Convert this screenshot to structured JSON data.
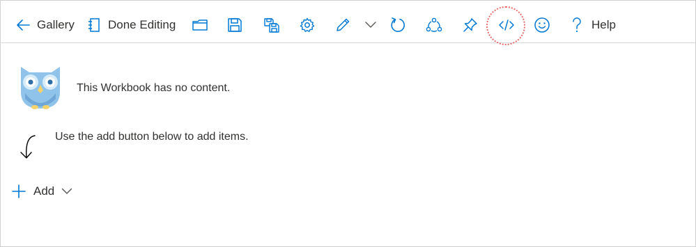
{
  "toolbar": {
    "gallery_label": "Gallery",
    "done_editing_label": "Done Editing",
    "help_label": "Help",
    "icons": [
      "back-arrow-icon",
      "done-editing-icon",
      "open-folder-icon",
      "save-icon",
      "save-as-icon",
      "settings-gear-icon",
      "edit-pencil-icon",
      "chevron-down-icon",
      "refresh-icon",
      "share-icon",
      "pin-icon",
      "code-icon",
      "feedback-smiley-icon",
      "help-question-icon"
    ],
    "highlighted_item": "code-icon"
  },
  "empty_state": {
    "message": "This Workbook has no content.",
    "hint": "Use the add button below to add items.",
    "mascot": "owl-icon"
  },
  "add": {
    "label": "Add"
  },
  "colors": {
    "accent": "#0078d4",
    "text": "#323130",
    "highlight": "#e86a6a",
    "owl_body": "#8fc3ea",
    "owl_beak": "#f3d26b"
  }
}
